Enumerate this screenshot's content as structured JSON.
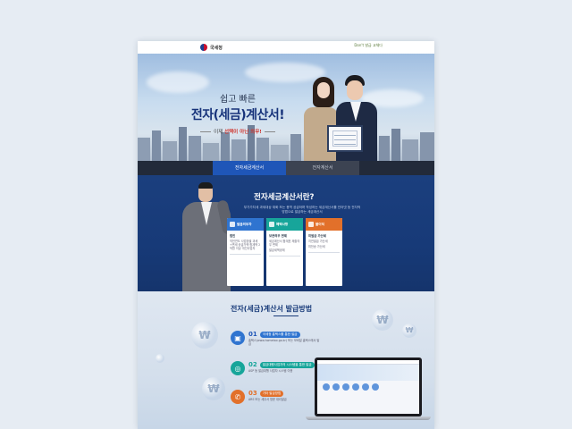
{
  "header": {
    "logo_text": "국세청",
    "campaign_text": "Don't\n발급 교체다"
  },
  "hero": {
    "line1": "쉽고 빠른",
    "line2": "전자(세금)계산서!",
    "sub_prefix": "이제",
    "sub_highlight": "선택이 아닌 의무!"
  },
  "tabs": [
    {
      "label": "전자세금계산서",
      "active": true
    },
    {
      "label": "전자계산서",
      "active": false
    }
  ],
  "about": {
    "title": "전자세금계산서란?",
    "description": "부가가치세 과세대상 재화 또는 용역 공급하며 작성하는 세금계산서를 인터넷 등 전자적 방법으로 발급하는 세금계산서",
    "cards": [
      {
        "label": "발급의무자",
        "color": "#2f74d0",
        "lines": [
          "법인",
          "직전연도 사업장별 과세+면세 공급가액 합계액 2억원 이상 개인사업자"
        ]
      },
      {
        "label": "혜택사항",
        "color": "#17a59a",
        "lines": [
          "보관의무 면제",
          "세금계산서 합계표 제출의무 면제",
          "발급세액공제"
        ]
      },
      {
        "label": "불이익",
        "color": "#e2702a",
        "lines": [
          "미발급 가산세",
          "지연발급 가산세",
          "미전송 가산세"
        ]
      }
    ]
  },
  "method": {
    "title": "전자(세금)계산서 발급방법",
    "steps": [
      {
        "num": "01",
        "label": "국세청 홈택스를 통한 발급",
        "desc": "홈택스(www.hometax.go.kr) 또는 모바일 홈택스에서 발급"
      },
      {
        "num": "02",
        "label": "발급대행사업자의 시스템을 통한 발급",
        "desc": "ASP 등 발급대행 사업자 시스템 이용"
      },
      {
        "num": "03",
        "label": "기타 발급방법",
        "desc": "ARS 또는 세무서 방문 대리발급"
      }
    ],
    "bubble_symbol": "₩"
  }
}
